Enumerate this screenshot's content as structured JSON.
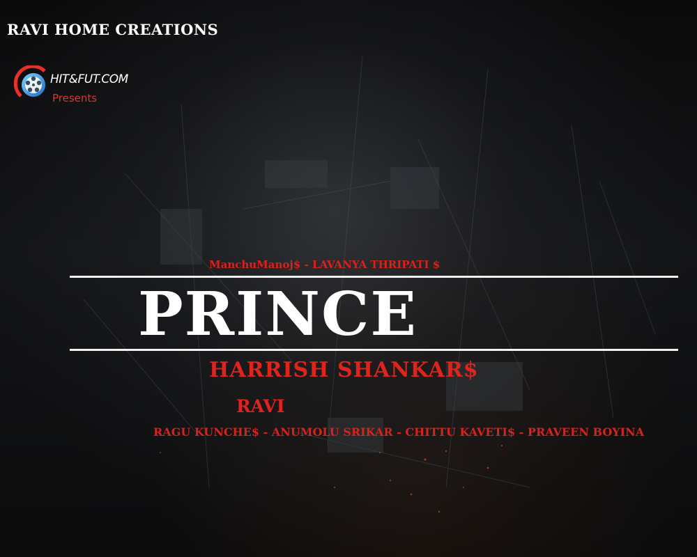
{
  "studio": "RAVI HOME CREATIONS",
  "logo": {
    "site": "HIT&FUT.COM",
    "tagline": "Presents"
  },
  "cast_line": "ManchuManoj$ - LAVANYA THRIPATI $",
  "title": "PRINCE",
  "director": "HARRISH SHANKAR$",
  "producer": "RAVI",
  "crew_line": "RAGU KUNCHE$ - ANUMOLU SRIKAR -  CHITTU KAVETI$ - PRAVEEN BOYINA",
  "colors": {
    "background": "#000000",
    "title": "#ffffff",
    "accent_red": "#e0241d",
    "rule": "#f2f2f2"
  },
  "icons": [
    "film-reel-icon"
  ]
}
